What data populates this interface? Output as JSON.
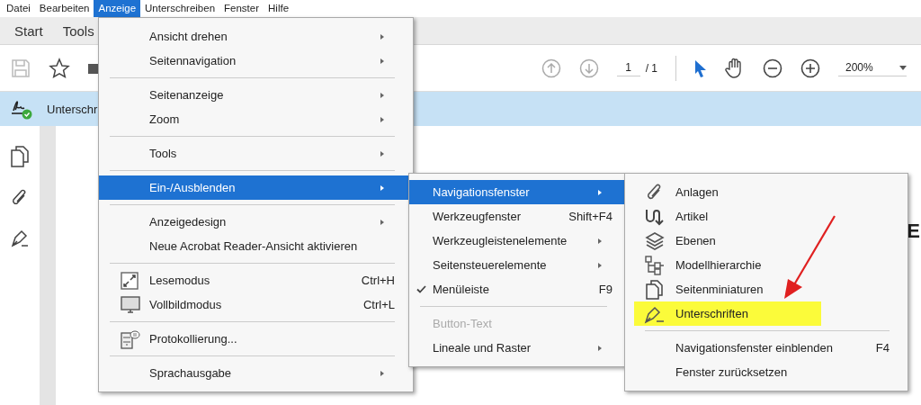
{
  "menubar": [
    {
      "label": "Datei",
      "selected": false
    },
    {
      "label": "Bearbeiten",
      "selected": false
    },
    {
      "label": "Anzeige",
      "selected": true
    },
    {
      "label": "Unterschreiben",
      "selected": false
    },
    {
      "label": "Fenster",
      "selected": false
    },
    {
      "label": "Hilfe",
      "selected": false
    }
  ],
  "tabs": [
    "Start",
    "Tools"
  ],
  "toolbar": {
    "page": "1",
    "page_total": "/ 1",
    "zoom": "200%"
  },
  "sign_bar": {
    "label": "Unterschr"
  },
  "document": {
    "text": "E"
  },
  "view_menu": [
    {
      "kind": "item",
      "label": "Ansicht drehen",
      "submenu": true,
      "selected": false
    },
    {
      "kind": "item",
      "label": "Seitennavigation",
      "submenu": true,
      "selected": false
    },
    {
      "kind": "separator"
    },
    {
      "kind": "item",
      "label": "Seitenanzeige",
      "submenu": true,
      "selected": false
    },
    {
      "kind": "item",
      "label": "Zoom",
      "submenu": true,
      "selected": false
    },
    {
      "kind": "separator"
    },
    {
      "kind": "item",
      "label": "Tools",
      "submenu": true,
      "selected": false
    },
    {
      "kind": "separator"
    },
    {
      "kind": "item",
      "label": "Ein-/Ausblenden",
      "submenu": true,
      "selected": true
    },
    {
      "kind": "separator"
    },
    {
      "kind": "item",
      "label": "Anzeigedesign",
      "submenu": true,
      "selected": false
    },
    {
      "kind": "item",
      "label": "Neue Acrobat Reader-Ansicht aktivieren",
      "submenu": false,
      "selected": false
    },
    {
      "kind": "separator"
    },
    {
      "kind": "icon-item",
      "label": "Lesemodus",
      "shortcut": "Ctrl+H",
      "submenu": false,
      "selected": false
    },
    {
      "kind": "icon-item",
      "label": "Vollbildmodus",
      "shortcut": "Ctrl+L",
      "submenu": false,
      "selected": false
    },
    {
      "kind": "separator"
    },
    {
      "kind": "icon-item",
      "label": "Protokollierung...",
      "submenu": false,
      "selected": false
    },
    {
      "kind": "separator"
    },
    {
      "kind": "item",
      "label": "Sprachausgabe",
      "submenu": true,
      "selected": false
    }
  ],
  "show_hide_menu": [
    {
      "kind": "item",
      "label": "Navigationsfenster",
      "submenu": true,
      "selected": true,
      "checked": false,
      "disabled": false
    },
    {
      "kind": "item",
      "label": "Werkzeugfenster",
      "shortcut": "Shift+F4",
      "submenu": false,
      "selected": false,
      "checked": false,
      "disabled": false
    },
    {
      "kind": "item",
      "label": "Werkzeugleistenelemente",
      "submenu": true,
      "selected": false,
      "checked": false,
      "disabled": false
    },
    {
      "kind": "item",
      "label": "Seitensteuerelemente",
      "submenu": true,
      "selected": false,
      "checked": false,
      "disabled": false
    },
    {
      "kind": "item",
      "label": "Menüleiste",
      "shortcut": "F9",
      "submenu": false,
      "selected": false,
      "checked": true,
      "disabled": false
    },
    {
      "kind": "separator"
    },
    {
      "kind": "item",
      "label": "Button-Text",
      "submenu": false,
      "selected": false,
      "checked": false,
      "disabled": true
    },
    {
      "kind": "item",
      "label": "Lineale und Raster",
      "submenu": true,
      "selected": false,
      "checked": false,
      "disabled": false
    }
  ],
  "navigation_menu": [
    {
      "kind": "icon-item",
      "label": "Anlagen",
      "selected": false,
      "highlighted": false
    },
    {
      "kind": "icon-item",
      "label": "Artikel",
      "selected": false,
      "highlighted": false
    },
    {
      "kind": "icon-item",
      "label": "Ebenen",
      "selected": false,
      "highlighted": false
    },
    {
      "kind": "icon-item",
      "label": "Modellhierarchie",
      "selected": false,
      "highlighted": false
    },
    {
      "kind": "icon-item",
      "label": "Seitenminiaturen",
      "selected": false,
      "highlighted": false
    },
    {
      "kind": "icon-item",
      "label": "Unterschriften",
      "selected": false,
      "highlighted": true
    },
    {
      "kind": "separator"
    },
    {
      "kind": "item",
      "label": "Navigationsfenster einblenden",
      "shortcut": "F4",
      "selected": false,
      "highlighted": false
    },
    {
      "kind": "item",
      "label": "Fenster zurücksetzen",
      "selected": false,
      "highlighted": false
    }
  ]
}
